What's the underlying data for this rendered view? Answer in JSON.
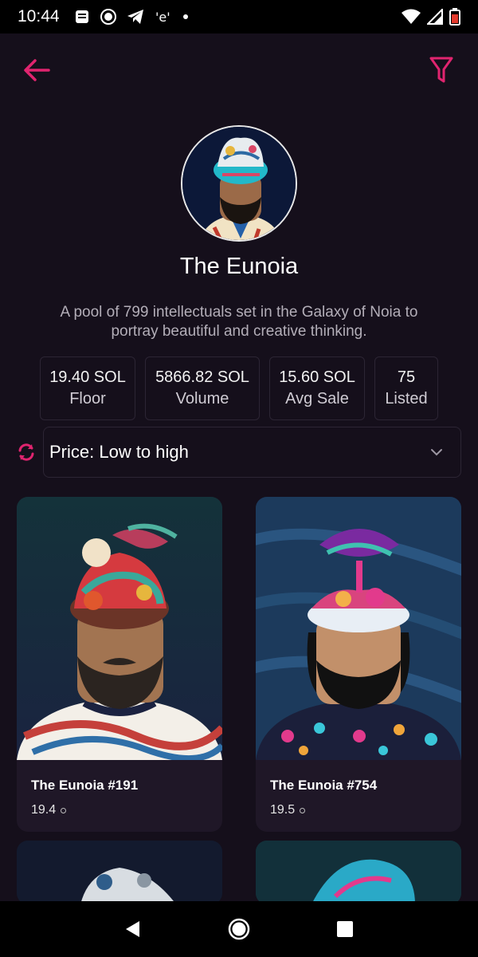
{
  "status_bar": {
    "time": "10:44",
    "left_icons": [
      "notes-icon",
      "messenger-icon",
      "telegram-icon",
      "app-icon",
      "dot-icon"
    ],
    "right_icons": [
      "wifi-icon",
      "signal-icon",
      "battery-icon"
    ]
  },
  "header": {
    "back_icon": "arrow-left-icon",
    "filter_icon": "filter-icon",
    "accent_color": "#e0246f"
  },
  "collection": {
    "name": "The Eunoia",
    "description": "A pool of 799 intellectuals set in the Galaxy of Noia to portray beautiful and creative thinking."
  },
  "stats": [
    {
      "value": "19.40 SOL",
      "label": "Floor"
    },
    {
      "value": "5866.82 SOL",
      "label": "Volume"
    },
    {
      "value": "15.60 SOL",
      "label": "Avg Sale"
    },
    {
      "value": "75",
      "label": "Listed"
    }
  ],
  "sort": {
    "selected": "Price: Low to high",
    "refresh_icon": "refresh-icon",
    "chevron_icon": "chevron-down-icon"
  },
  "items": [
    {
      "name": "The Eunoia #191",
      "price": "19.4"
    },
    {
      "name": "The Eunoia #754",
      "price": "19.5"
    }
  ],
  "nav": {
    "icons": [
      "back-triangle-icon",
      "home-circle-icon",
      "recents-square-icon"
    ]
  }
}
